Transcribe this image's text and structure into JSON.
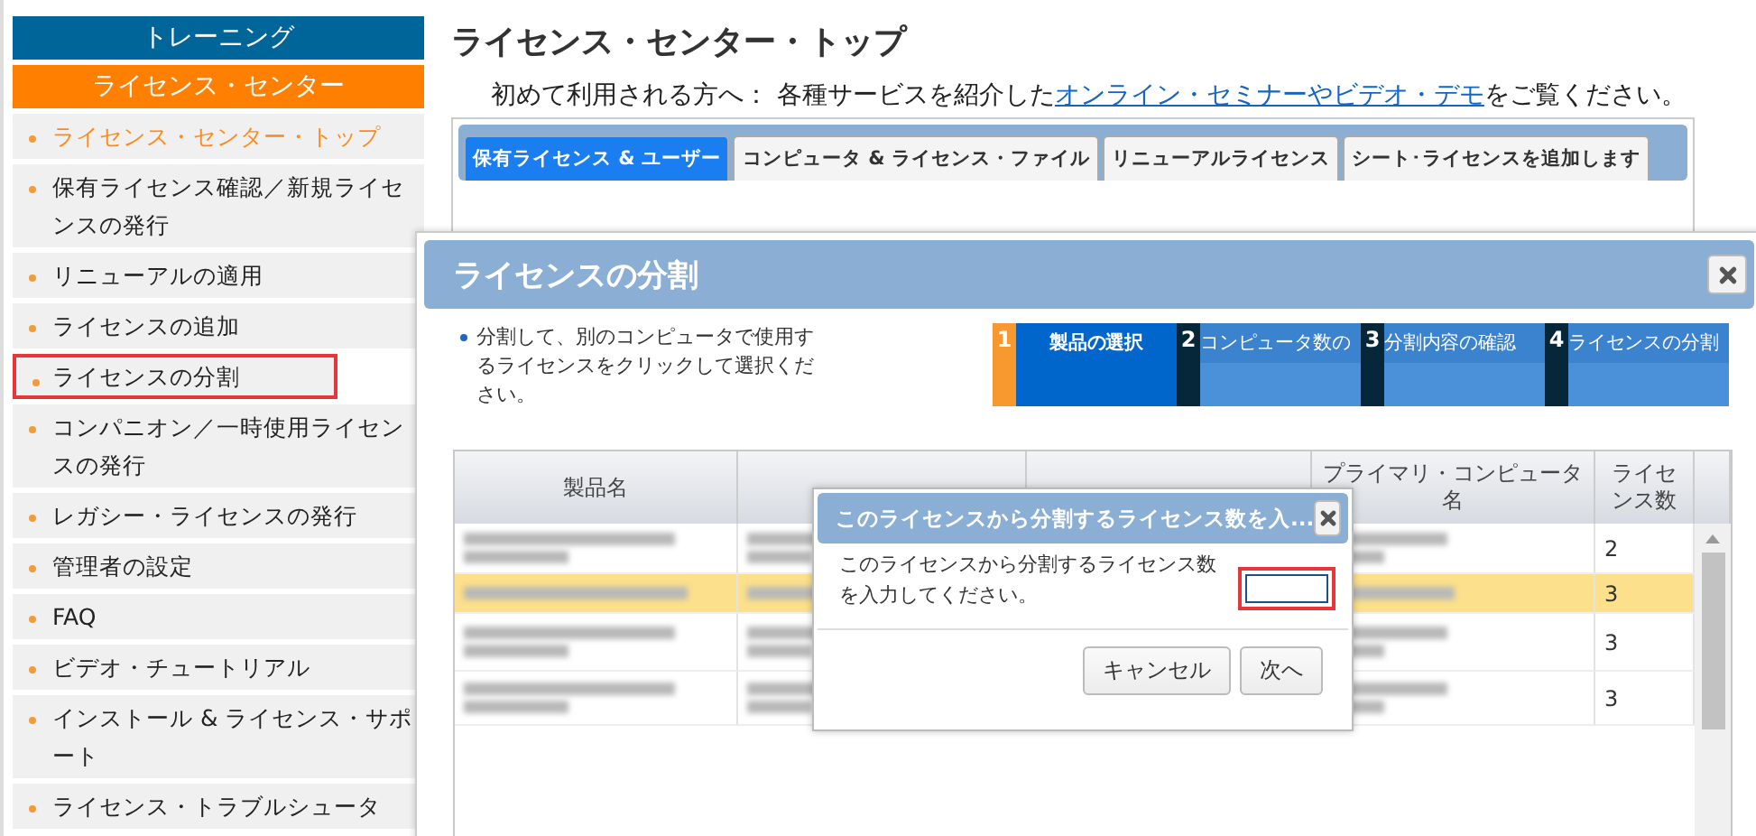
{
  "sidebar": {
    "header": "トレーニング",
    "section": "ライセンス・センター",
    "items": [
      {
        "label": "ライセンス・センター・トップ",
        "selected": true,
        "highlighted": false
      },
      {
        "label": "保有ライセンス確認／新規ライセンスの発行",
        "selected": false,
        "highlighted": false
      },
      {
        "label": "リニューアルの適用",
        "selected": false,
        "highlighted": false
      },
      {
        "label": "ライセンスの追加",
        "selected": false,
        "highlighted": false
      },
      {
        "label": "ライセンスの分割",
        "selected": false,
        "highlighted": true
      },
      {
        "label": "コンパニオン／一時使用ライセンスの発行",
        "selected": false,
        "highlighted": false
      },
      {
        "label": "レガシー・ライセンスの発行",
        "selected": false,
        "highlighted": false
      },
      {
        "label": "管理者の設定",
        "selected": false,
        "highlighted": false
      },
      {
        "label": "FAQ",
        "selected": false,
        "highlighted": false
      },
      {
        "label": "ビデオ・チュートリアル",
        "selected": false,
        "highlighted": false
      },
      {
        "label": "インストール & ライセンス・サポート",
        "selected": false,
        "highlighted": false
      },
      {
        "label": "ライセンス・トラブルシュータ",
        "selected": false,
        "highlighted": false
      }
    ]
  },
  "page": {
    "title": "ライセンス・センター・トップ",
    "intro": {
      "before": "初めて利用される方へ： 各種サービスを紹介した",
      "link": "オンライン・セミナーやビデオ・デモ",
      "after": "をご覧ください。"
    },
    "tabs": [
      {
        "label": "保有ライセンス & ユーザー",
        "selected": true
      },
      {
        "label": "コンピュータ & ライセンス・ファイル",
        "selected": false
      },
      {
        "label": "リニューアルライセンス",
        "selected": false
      },
      {
        "label": "シート･ライセンスを追加します",
        "selected": false
      }
    ]
  },
  "dialog": {
    "title": "ライセンスの分割",
    "instruction": "分割して、別のコンピュータで使用するライセンスをクリックして選択ください。",
    "steps": [
      {
        "number": "1",
        "label": "製品の選択",
        "selected": true
      },
      {
        "number": "2",
        "label": "コンピュータ数の",
        "selected": false
      },
      {
        "number": "3",
        "label": "分割内容の確認",
        "selected": false
      },
      {
        "number": "4",
        "label": "ライセンスの分割",
        "selected": false
      }
    ],
    "table": {
      "columns": [
        {
          "kind": "text",
          "label": "製品名"
        },
        {
          "kind": "covered"
        },
        {
          "kind": "covered"
        },
        {
          "kind": "text",
          "label": "プライマリ・コンピュータ名"
        },
        {
          "kind": "text",
          "label": "ライセンス数"
        }
      ],
      "rows": [
        {
          "selected": false,
          "count": "2"
        },
        {
          "selected": true,
          "count": "3"
        },
        {
          "selected": false,
          "count": "3"
        },
        {
          "selected": false,
          "count": "3"
        }
      ]
    }
  },
  "prompt": {
    "title": "このライセンスから分割するライセンス数を入...",
    "message": "このライセンスから分割するライセンス数を入力してください。",
    "input_highlighted": true,
    "buttons": [
      "キャンセル",
      "次へ"
    ]
  }
}
